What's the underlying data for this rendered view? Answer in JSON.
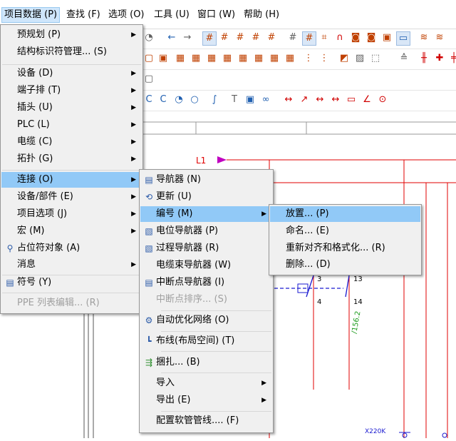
{
  "menubar": {
    "items": [
      "项目数据 (P)",
      "查找 (F)",
      "选项 (O)",
      "工具 (U)",
      "窗口 (W)",
      "帮助 (H)"
    ]
  },
  "main_menu": {
    "items": [
      {
        "label": "预规划 (P)",
        "submenu": true
      },
      {
        "label": "结构标识符管理... (S)",
        "submenu": false
      },
      {
        "label": "设备 (D)",
        "submenu": true
      },
      {
        "label": "端子排 (T)",
        "submenu": true
      },
      {
        "label": "插头 (U)",
        "submenu": true
      },
      {
        "label": "PLC (L)",
        "submenu": true
      },
      {
        "label": "电缆 (C)",
        "submenu": true
      },
      {
        "label": "拓扑 (G)",
        "submenu": true
      },
      {
        "label": "连接 (O)",
        "submenu": true
      },
      {
        "label": "设备/部件 (E)",
        "submenu": true
      },
      {
        "label": "项目选项 (J)",
        "submenu": true
      },
      {
        "label": "宏 (M)",
        "submenu": true
      },
      {
        "label": "占位符对象 (A)",
        "submenu": false
      },
      {
        "label": "消息",
        "submenu": true
      },
      {
        "label": "符号 (Y)",
        "submenu": false
      },
      {
        "label": "PPE 列表编辑... (R)",
        "submenu": false
      }
    ]
  },
  "connection_menu": {
    "items": [
      {
        "label": "导航器 (N)"
      },
      {
        "label": "更新 (U)"
      },
      {
        "label": "编号 (M)"
      },
      {
        "label": "电位导航器 (P)"
      },
      {
        "label": "过程导航器 (R)"
      },
      {
        "label": "电缆束导航器 (W)"
      },
      {
        "label": "中断点导航器 (I)"
      },
      {
        "label": "中断点排序... (S)"
      },
      {
        "label": "自动优化网络 (O)"
      },
      {
        "label": "布线(布局空间) (T)"
      },
      {
        "label": "捆扎... (B)"
      },
      {
        "label": "导入"
      },
      {
        "label": "导出 (E)"
      },
      {
        "label": "配置软管管线.... (F)"
      }
    ]
  },
  "numbering_menu": {
    "items": [
      {
        "label": "放置... (P)"
      },
      {
        "label": "命名... (E)"
      },
      {
        "label": "重新对齐和格式化... (R)"
      },
      {
        "label": "删除... (D)"
      }
    ]
  },
  "drawing": {
    "potential_label": "L1",
    "terminal_3": "3",
    "terminal_13": "13",
    "terminal_4": "4",
    "terminal_14": "14",
    "crossref": "/156.2",
    "device_label": "X220K"
  },
  "colors": {
    "highlight": "#91c9f7",
    "wire_red": "#e00000",
    "wire_blue": "#1a1ad0",
    "crossref_green": "#1a9a1a",
    "potential_magenta": "#c000c0"
  }
}
